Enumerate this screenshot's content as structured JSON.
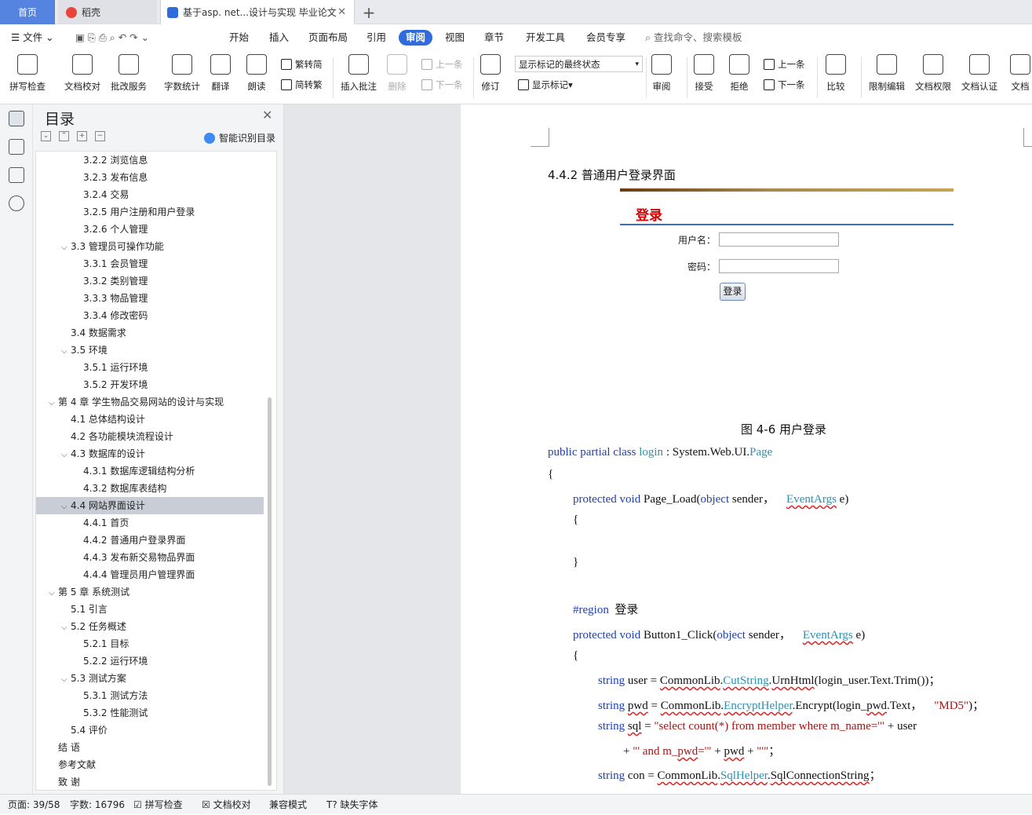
{
  "tabs": {
    "home": "首页",
    "daoke": "稻壳",
    "doc": "基于asp. net...设计与实现 毕业论文"
  },
  "menu": {
    "file": "文件",
    "items": [
      "开始",
      "插入",
      "页面布局",
      "引用",
      "审阅",
      "视图",
      "章节",
      "开发工具",
      "会员专享"
    ],
    "active": "审阅",
    "search": "查找命令、搜索模板"
  },
  "ribbon": {
    "spell": "拼写检查",
    "proof": "文档校对",
    "annotate": "批改服务",
    "wordcount": "字数统计",
    "translate": "翻译",
    "read": "朗读",
    "trad": "繁转简",
    "simp": "简转繁",
    "insert_comment": "插入批注",
    "delete": "删除",
    "prev_comment": "上一条",
    "next_comment": "下一条",
    "revise": "修订",
    "markup_state": "显示标记的最终状态",
    "show_markup": "显示标记",
    "review": "审阅",
    "accept": "接受",
    "reject": "拒绝",
    "prev": "上一条",
    "next": "下一条",
    "compare": "比较",
    "restrict": "限制编辑",
    "rights": "文档权限",
    "cert": "文档认证",
    "doc_more": "文档"
  },
  "nav": {
    "title": "目录",
    "smart": "智能识别目录",
    "items": [
      {
        "text": "3.2.2 浏览信息",
        "level": 3,
        "arrow": ""
      },
      {
        "text": "3.2.3 发布信息",
        "level": 3,
        "arrow": ""
      },
      {
        "text": "3.2.4  交易",
        "level": 3,
        "arrow": ""
      },
      {
        "text": "3.2.5 用户注册和用户登录",
        "level": 3,
        "arrow": ""
      },
      {
        "text": "3.2.6 个人管理",
        "level": 3,
        "arrow": ""
      },
      {
        "text": "3.3 管理员可操作功能",
        "level": 2,
        "arrow": "v"
      },
      {
        "text": "3.3.1 会员管理",
        "level": 3,
        "arrow": ""
      },
      {
        "text": "3.3.2 类别管理",
        "level": 3,
        "arrow": ""
      },
      {
        "text": "3.3.3 物品管理",
        "level": 3,
        "arrow": ""
      },
      {
        "text": "3.3.4  修改密码",
        "level": 3,
        "arrow": ""
      },
      {
        "text": "3.4 数据需求",
        "level": 2,
        "arrow": ""
      },
      {
        "text": "3.5 环境",
        "level": 2,
        "arrow": "v"
      },
      {
        "text": "3.5.1 运行环境",
        "level": 3,
        "arrow": ""
      },
      {
        "text": "3.5.2 开发环境",
        "level": 3,
        "arrow": ""
      },
      {
        "text": "第 4 章  学生物品交易网站的设计与实现",
        "level": 1,
        "arrow": "v"
      },
      {
        "text": "4.1 总体结构设计",
        "level": 2,
        "arrow": ""
      },
      {
        "text": "4.2 各功能模块流程设计",
        "level": 2,
        "arrow": ""
      },
      {
        "text": "4.3 数据库的设计",
        "level": 2,
        "arrow": "v"
      },
      {
        "text": "4.3.1 数据库逻辑结构分析",
        "level": 3,
        "arrow": ""
      },
      {
        "text": "4.3.2 数据库表结构",
        "level": 3,
        "arrow": ""
      },
      {
        "text": "4.4 网站界面设计",
        "level": 2,
        "arrow": "v",
        "selected": true
      },
      {
        "text": "4.4.1 首页",
        "level": 3,
        "arrow": ""
      },
      {
        "text": "4.4.2 普通用户登录界面",
        "level": 3,
        "arrow": ""
      },
      {
        "text": "4.4.3 发布新交易物品界面",
        "level": 3,
        "arrow": ""
      },
      {
        "text": "4.4.4 管理员用户管理界面",
        "level": 3,
        "arrow": ""
      },
      {
        "text": "第 5 章  系统测试",
        "level": 1,
        "arrow": "v"
      },
      {
        "text": "5.1  引言",
        "level": 2,
        "arrow": ""
      },
      {
        "text": "5.2  任务概述",
        "level": 2,
        "arrow": "v"
      },
      {
        "text": "5.2.1  目标",
        "level": 3,
        "arrow": ""
      },
      {
        "text": "5.2.2  运行环境",
        "level": 3,
        "arrow": ""
      },
      {
        "text": "5.3  测试方案",
        "level": 2,
        "arrow": "v"
      },
      {
        "text": "5.3.1  测试方法",
        "level": 3,
        "arrow": ""
      },
      {
        "text": "5.3.2  性能测试",
        "level": 3,
        "arrow": ""
      },
      {
        "text": "5.4  评价",
        "level": 2,
        "arrow": ""
      },
      {
        "text": "结    语",
        "level": 1,
        "arrow": ""
      },
      {
        "text": "参考文献",
        "level": 1,
        "arrow": ""
      },
      {
        "text": "致    谢",
        "level": 1,
        "arrow": ""
      }
    ]
  },
  "doc": {
    "heading": "4.4.2 普通用户登录界面",
    "figure": {
      "title": "登录",
      "user_label": "用户名：",
      "pwd_label": "密码：",
      "button": "登录"
    },
    "caption": "图 4-6  用户登录"
  },
  "status": {
    "page": "页面: 39/58",
    "words": "字数: 16796",
    "spell": "拼写检查",
    "proof": "文档校对",
    "compat": "兼容模式",
    "missing_font": "缺失字体"
  }
}
